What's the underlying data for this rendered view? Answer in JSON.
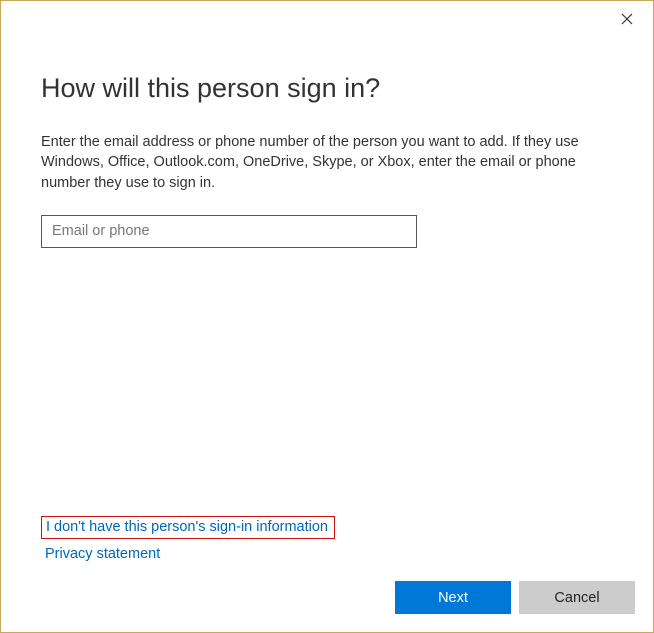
{
  "title": "How will this person sign in?",
  "description": "Enter the email address or phone number of the person you want to add. If they use Windows, Office, Outlook.com, OneDrive, Skype, or Xbox, enter the email or phone number they use to sign in.",
  "input": {
    "placeholder": "Email or phone",
    "value": ""
  },
  "links": {
    "no_info": "I don't have this person's sign-in information",
    "privacy": "Privacy statement"
  },
  "buttons": {
    "next": "Next",
    "cancel": "Cancel"
  }
}
